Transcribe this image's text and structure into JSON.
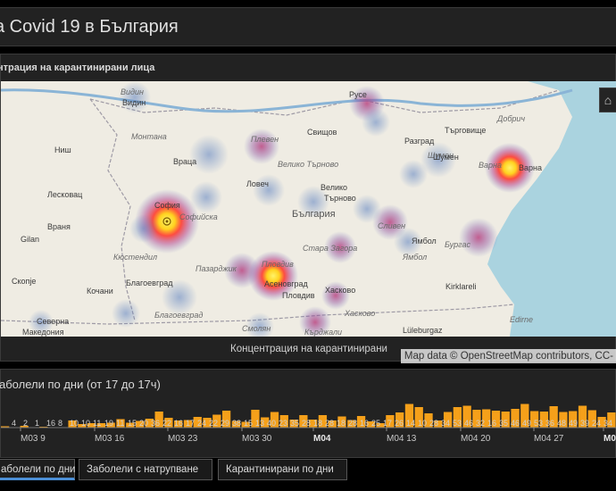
{
  "header": {
    "title": "а Covid 19 в България"
  },
  "map_panel": {
    "title": "нтрация на карантинирани лица",
    "attribution": "Map data © OpenStreetMap contributors, CC-",
    "caption": "Концентрация на карантинирани",
    "home_icon": "home-icon",
    "labels": [
      {
        "name": "Видин",
        "style": "it"
      },
      {
        "name": "Русе",
        "style": "n"
      },
      {
        "name": "Добрич",
        "style": "it"
      },
      {
        "name": "Видин",
        "style": "n"
      },
      {
        "name": "Монтана",
        "style": "it"
      },
      {
        "name": "Плевен",
        "style": "it"
      },
      {
        "name": "Свищов",
        "style": "n"
      },
      {
        "name": "Шумен",
        "style": "it"
      },
      {
        "name": "Разград",
        "style": "n"
      },
      {
        "name": "Търговище",
        "style": "n"
      },
      {
        "name": "Враца",
        "style": "n"
      },
      {
        "name": "Велико Търново",
        "style": "it"
      },
      {
        "name": "Шумен",
        "style": "n"
      },
      {
        "name": "Варна",
        "style": "it"
      },
      {
        "name": "Варна",
        "style": "n"
      },
      {
        "name": "Ниш",
        "style": "n"
      },
      {
        "name": "Ловеч",
        "style": "n"
      },
      {
        "name": "Велико",
        "style": "n"
      },
      {
        "name": "Търново",
        "style": "n"
      },
      {
        "name": "Лесковац",
        "style": "n"
      },
      {
        "name": "София",
        "style": "n"
      },
      {
        "name": "Софийска",
        "style": "it"
      },
      {
        "name": "България",
        "style": "b"
      },
      {
        "name": "Сливен",
        "style": "it"
      },
      {
        "name": "Враня",
        "style": "n"
      },
      {
        "name": "Ямбол",
        "style": "n"
      },
      {
        "name": "Бургас",
        "style": "it"
      },
      {
        "name": "Gilan",
        "style": "n"
      },
      {
        "name": "Кюстендил",
        "style": "it"
      },
      {
        "name": "Стара Загора",
        "style": "it"
      },
      {
        "name": "Пазарджик",
        "style": "it"
      },
      {
        "name": "Пловдив",
        "style": "it"
      },
      {
        "name": "Ямбол",
        "style": "it"
      },
      {
        "name": "Скопје",
        "style": "n"
      },
      {
        "name": "Благоевград",
        "style": "n"
      },
      {
        "name": "Асеновград",
        "style": "n"
      },
      {
        "name": "Пловдив",
        "style": "n"
      },
      {
        "name": "Кочани",
        "style": "n"
      },
      {
        "name": "Хасково",
        "style": "n"
      },
      {
        "name": "Kirklareli",
        "style": "n"
      },
      {
        "name": "Благоевград",
        "style": "it"
      },
      {
        "name": "Хасково",
        "style": "it"
      },
      {
        "name": "Северна",
        "style": "n"
      },
      {
        "name": "Македония",
        "style": "n"
      },
      {
        "name": "Смолян",
        "style": "it"
      },
      {
        "name": "Lüleburgaz",
        "style": "n"
      },
      {
        "name": "Кърджали",
        "style": "it"
      },
      {
        "name": "Edirne",
        "style": "it"
      }
    ]
  },
  "chart_panel": {
    "title": "аболели по дни (от 17 до 17ч)",
    "chart_data": {
      "type": "bar",
      "values": [
        3,
        0,
        4,
        0,
        2,
        1,
        1,
        16,
        8,
        10,
        10,
        11,
        19,
        11,
        15,
        20,
        36,
        22,
        16,
        17,
        24,
        22,
        29,
        38,
        15,
        13,
        40,
        23,
        35,
        28,
        18,
        28,
        18,
        28,
        16,
        25,
        17,
        26,
        14,
        10,
        28,
        34,
        53,
        46,
        32,
        16,
        35,
        46,
        49,
        40,
        41,
        38,
        36,
        42,
        53,
        37,
        36,
        48,
        35,
        37,
        49,
        39,
        24,
        34
      ],
      "labels_shown": [
        "4",
        "2",
        "1",
        "16",
        "8",
        "10",
        "10",
        "11",
        "19",
        "11",
        "15",
        "20",
        "36",
        "22",
        "16",
        "17",
        "24",
        "22",
        "29",
        "38",
        "15",
        "13",
        "40",
        "23",
        "35",
        "28",
        "18",
        "28",
        "18",
        "28",
        "16",
        "25",
        "17",
        "26",
        "14",
        "10",
        "28",
        "34",
        "53",
        "46",
        "32",
        "16",
        "35",
        "46",
        "49",
        "53",
        "36",
        "48",
        "49",
        "39",
        "24",
        "34"
      ],
      "ticks": [
        {
          "label": "M03 9",
          "bold": false
        },
        {
          "label": "M03 16",
          "bold": false
        },
        {
          "label": "M03 23",
          "bold": false
        },
        {
          "label": "M03 30",
          "bold": false
        },
        {
          "label": "M04",
          "bold": true
        },
        {
          "label": "M04 13",
          "bold": false
        },
        {
          "label": "M04 20",
          "bold": false
        },
        {
          "label": "M04 27",
          "bold": false
        },
        {
          "label": "M0",
          "bold": true
        }
      ],
      "color": "#f5a01a"
    }
  },
  "tabs": [
    {
      "label": "аболели по дни",
      "active": true
    },
    {
      "label": "Заболели с натрупване",
      "active": false
    },
    {
      "label": "Карантинирани по дни",
      "active": false
    }
  ]
}
